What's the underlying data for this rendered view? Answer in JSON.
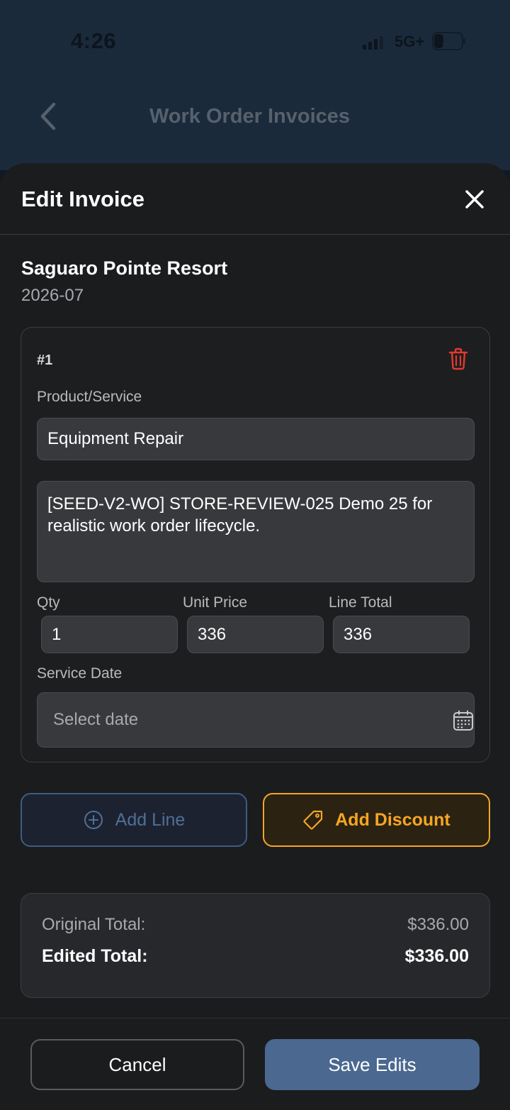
{
  "status_bar": {
    "time": "4:26",
    "network": "5G+",
    "battery": "25"
  },
  "nav": {
    "title": "Work Order Invoices"
  },
  "sheet": {
    "title": "Edit Invoice"
  },
  "invoice": {
    "customer": "Saguaro Pointe Resort",
    "period": "2026-07"
  },
  "line_item": {
    "number": "#1",
    "product_label": "Product/Service",
    "product_value": "Equipment Repair",
    "description": "[SEED-V2-WO] STORE-REVIEW-025 Demo 25 for realistic work order lifecycle.",
    "qty_label": "Qty",
    "qty_value": "1",
    "unit_price_label": "Unit Price",
    "unit_price_value": "336",
    "line_total_label": "Line Total",
    "line_total_value": "336",
    "service_date_label": "Service Date",
    "service_date_placeholder": "Select date"
  },
  "actions": {
    "add_line": "Add Line",
    "add_discount": "Add Discount"
  },
  "totals": {
    "original_label": "Original Total:",
    "original_value": "$336.00",
    "edited_label": "Edited Total:",
    "edited_value": "$336.00"
  },
  "footer": {
    "cancel": "Cancel",
    "save": "Save Edits"
  },
  "colors": {
    "accent_blue": "#4a6890",
    "accent_orange": "#f5a623",
    "danger_red": "#e0392f"
  }
}
